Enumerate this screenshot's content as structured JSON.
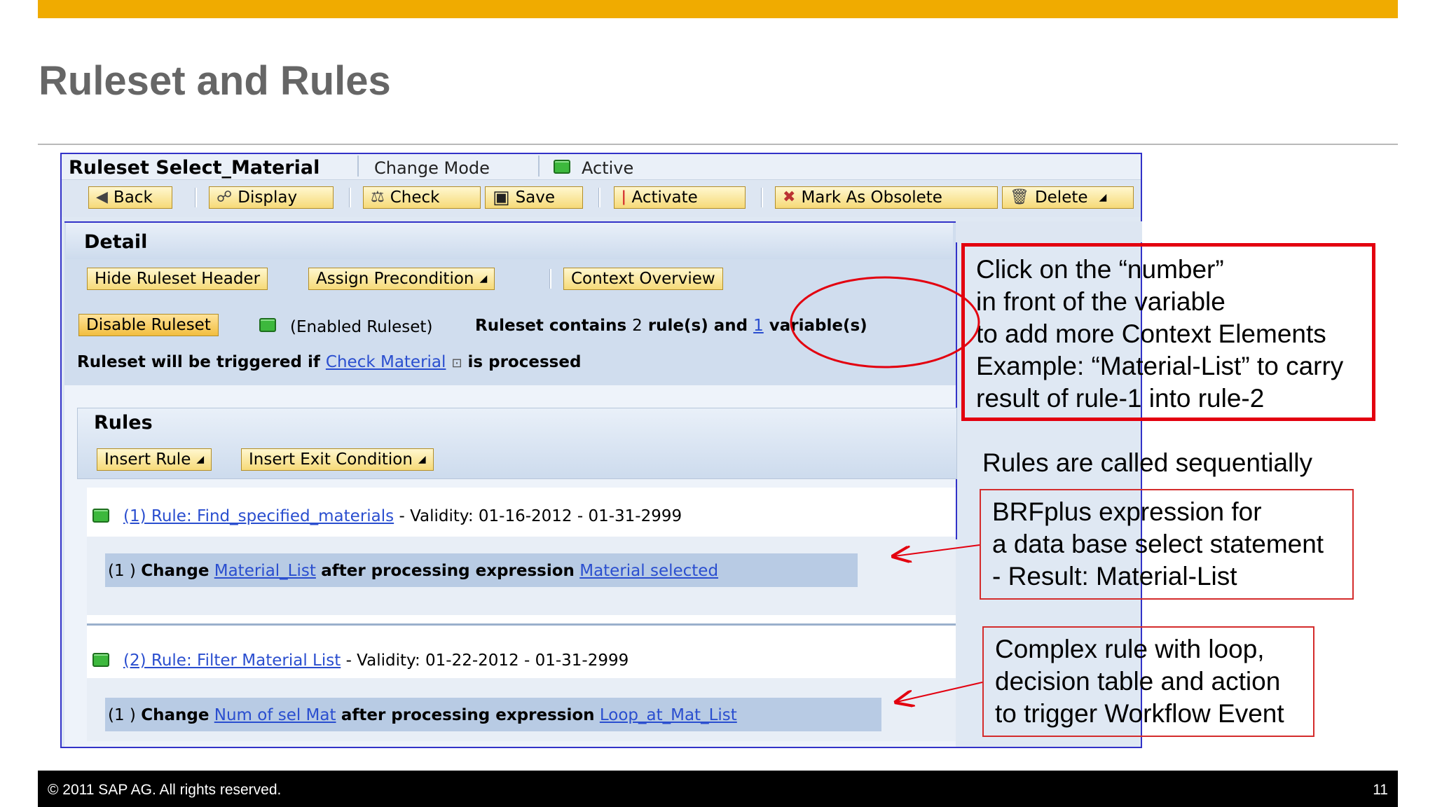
{
  "slide": {
    "title": "Ruleset and Rules"
  },
  "window": {
    "title": "Ruleset Select_Material",
    "mode": "Change Mode",
    "status": "Active"
  },
  "toolbar": {
    "back": "Back",
    "display": "Display",
    "check": "Check",
    "save": "Save",
    "activate": "Activate",
    "mark_obsolete": "Mark As Obsolete",
    "delete": "Delete"
  },
  "detail": {
    "heading": "Detail",
    "hide_header": "Hide Ruleset Header",
    "assign_precondition": "Assign Precondition",
    "context_overview": "Context Overview",
    "disable_ruleset": "Disable Ruleset",
    "enabled_text": "(Enabled Ruleset)",
    "contains_prefix": "Ruleset contains",
    "rule_count": "2",
    "contains_mid": "rule(s) and",
    "variable_count": "1",
    "contains_suffix": "variable(s)",
    "trigger_prefix": "Ruleset will be triggered if",
    "trigger_link": "Check Material",
    "trigger_suffix": "is processed"
  },
  "rules": {
    "heading": "Rules",
    "insert_rule": "Insert Rule",
    "insert_exit": "Insert Exit Condition",
    "items": [
      {
        "link": "(1) Rule: Find_specified_materials",
        "validity": "- Validity: 01-16-2012 - 01-31-2999",
        "action_num": "(1 )",
        "action_change": "Change",
        "action_var": "Material_List",
        "action_mid": "after processing expression",
        "action_expr": "Material selected"
      },
      {
        "link": "(2) Rule: Filter Material List",
        "validity": "- Validity: 01-22-2012 - 01-31-2999",
        "action_num": "(1 )",
        "action_change": "Change",
        "action_var": "Num of sel Mat",
        "action_mid": "after processing expression",
        "action_expr": "Loop_at_Mat_List"
      }
    ]
  },
  "notes": {
    "red_box": [
      "Click on the “number”",
      "in front of the variable",
      "to add more Context Elements",
      "Example: “Material-List” to carry",
      "result of rule-1 into rule-2"
    ],
    "sequential": "Rules are called sequentially",
    "box1": [
      "BRFplus expression for",
      "a data base select statement",
      "- Result: Material-List"
    ],
    "box2": [
      "Complex rule with loop,",
      "decision table and action",
      "to trigger Workflow Event"
    ]
  },
  "footer": {
    "copyright": "© 2011 SAP AG. All rights reserved.",
    "page": "11"
  },
  "colors": {
    "accent": "#f0ab00",
    "window_border": "#3232c8",
    "annotation_red": "#e3000f",
    "status_green": "#3db83d",
    "link_blue": "#2a4ecf"
  }
}
